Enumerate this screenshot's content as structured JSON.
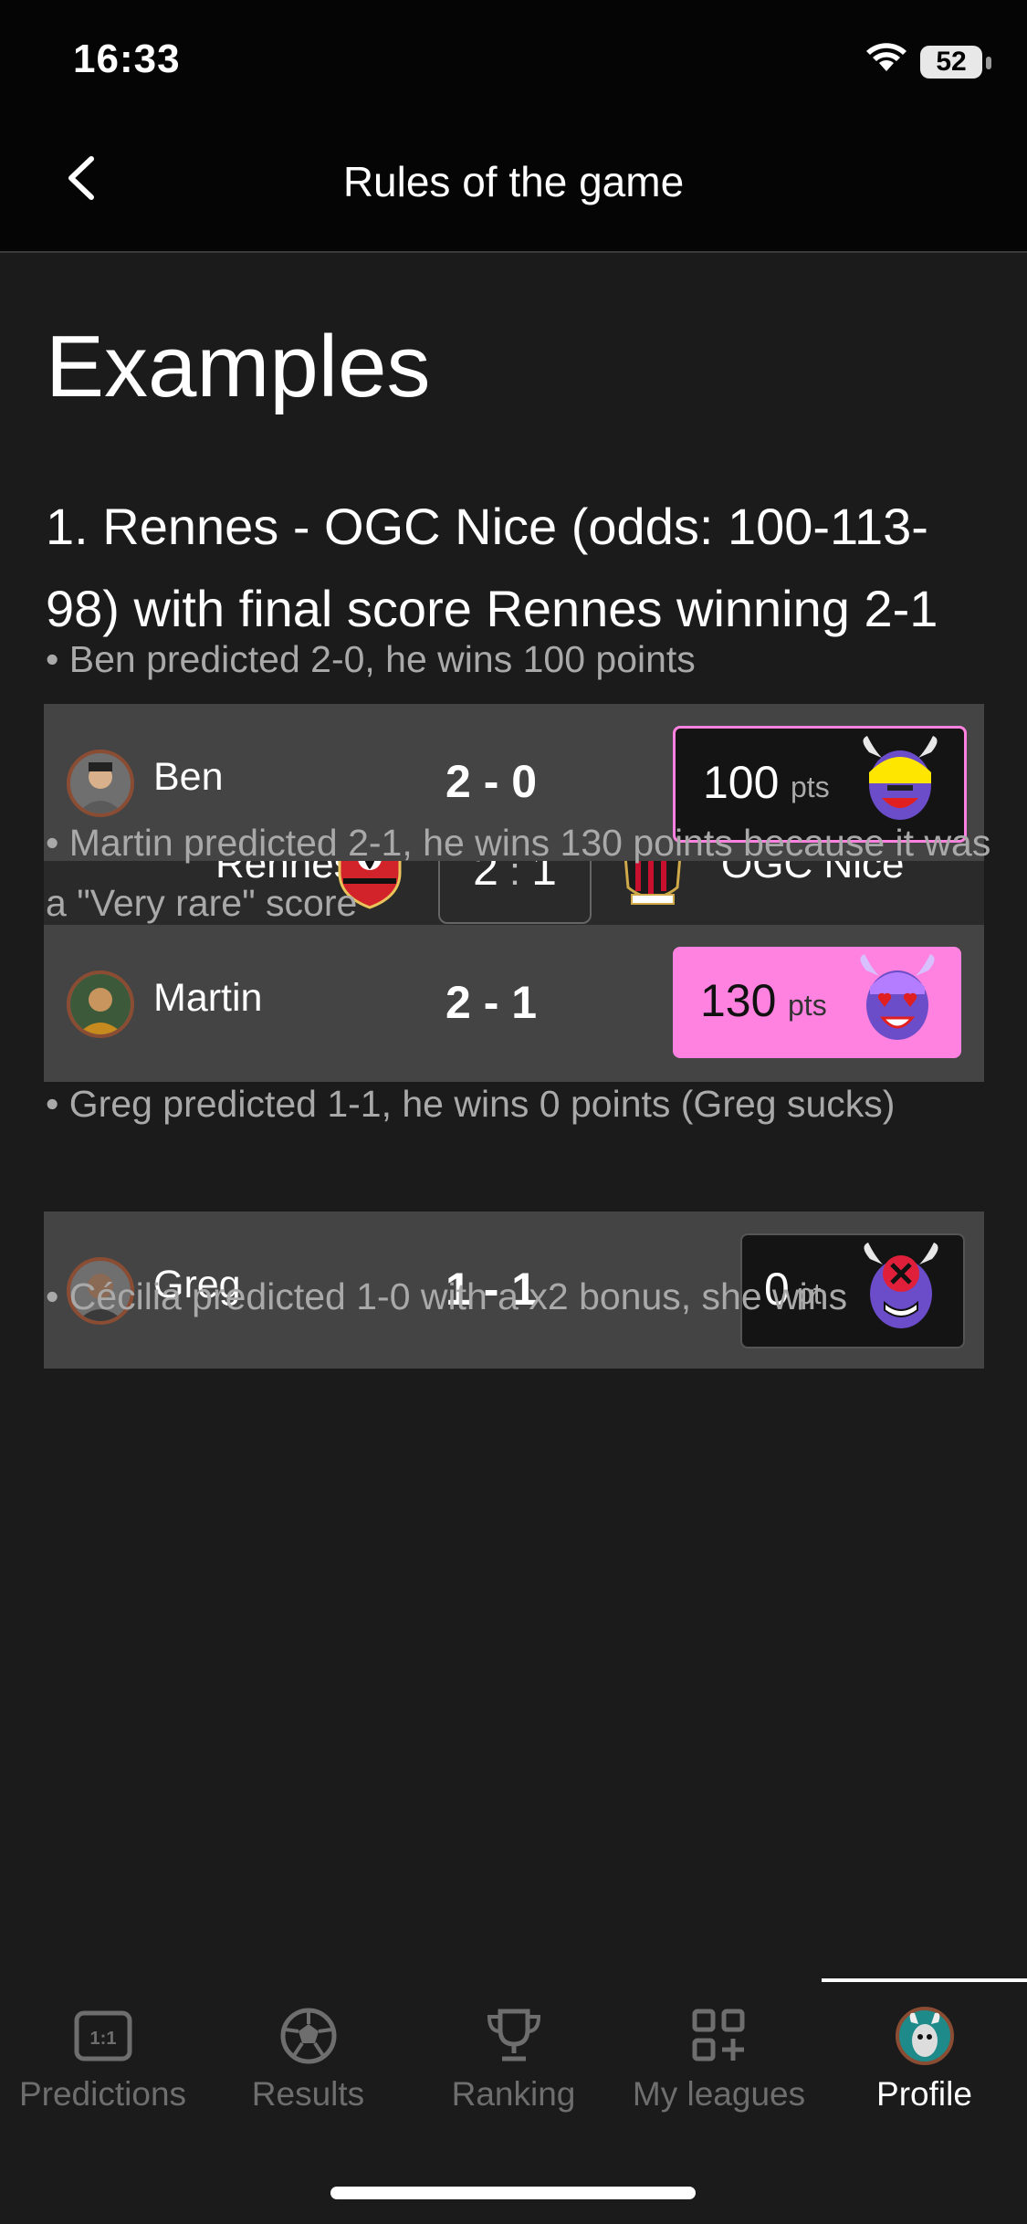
{
  "status": {
    "time": "16:33",
    "battery": "52"
  },
  "nav": {
    "title": "Rules of the game"
  },
  "content": {
    "heading": "Examples",
    "example_title": "1. Rennes - OGC Nice (odds: 100-113-98) with final score Rennes winning 2-1",
    "match": {
      "home": "Rennes",
      "away": "OGC Nice",
      "home_score": "2",
      "sep": ":",
      "away_score": "1"
    },
    "notes": [
      "• Ben predicted 2-0, he wins 100 points",
      "• Martin predicted 2-1, he wins 130 points because it was a \"Very rare\" score",
      "• Greg predicted 1-1, he wins 0 points (Greg sucks)",
      "• Cécilia predicted 1-0 with a x2 bonus, she wins"
    ],
    "predictions": [
      {
        "name": "Ben",
        "score": "2 - 0",
        "points": "100",
        "unit": "pts"
      },
      {
        "name": "Martin",
        "score": "2 - 1",
        "points": "130",
        "unit": "pts"
      },
      {
        "name": "Greg",
        "score": "1 - 1",
        "points": "0",
        "unit": "pt"
      }
    ]
  },
  "tabs": [
    {
      "label": "Predictions",
      "icon": "predictions-icon"
    },
    {
      "label": "Results",
      "icon": "football-icon"
    },
    {
      "label": "Ranking",
      "icon": "trophy-icon"
    },
    {
      "label": "My leagues",
      "icon": "leagues-icon"
    },
    {
      "label": "Profile",
      "icon": "profile-avatar-icon"
    }
  ],
  "colors": {
    "accent_pink": "#ff82e0",
    "card_dark": "#2a2a2a",
    "card_gray": "#444444"
  }
}
